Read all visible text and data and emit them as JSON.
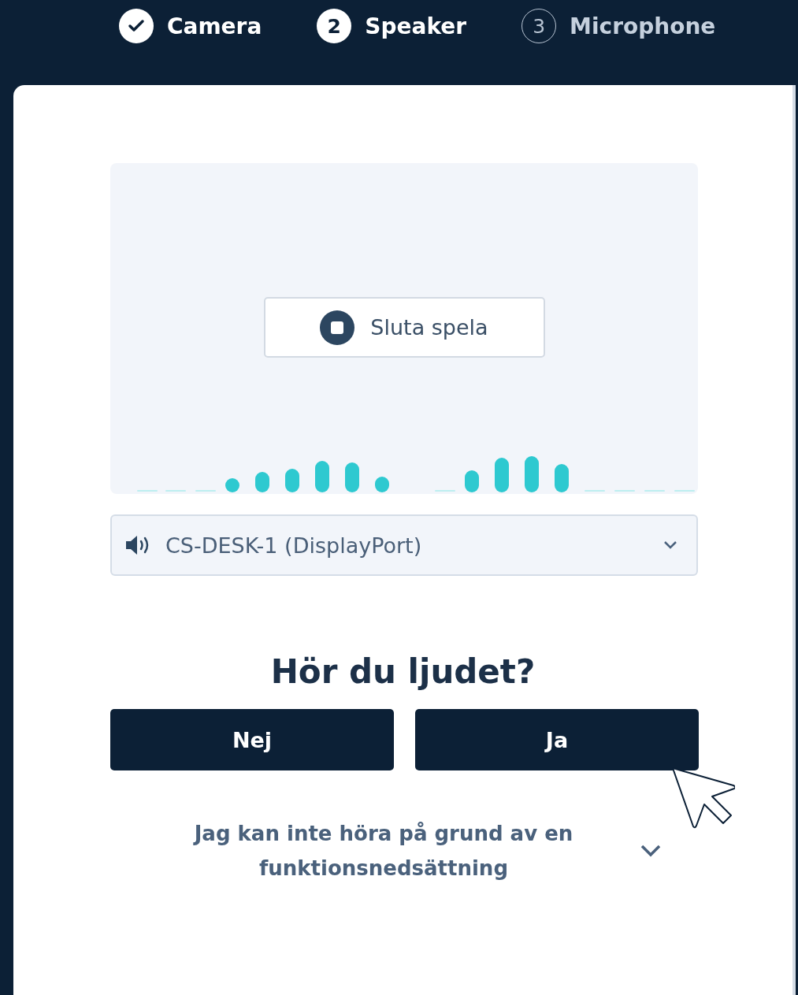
{
  "steps": [
    {
      "label": "Camera",
      "done": true,
      "selected": false
    },
    {
      "number": "2",
      "label": "Speaker",
      "done": false,
      "selected": true
    },
    {
      "number": "3",
      "label": "Microphone",
      "done": false,
      "selected": false
    }
  ],
  "preview": {
    "stop_button": {
      "label": "Sluta spela"
    }
  },
  "output_select": {
    "value": "CS-DESK-1 (DisplayPort)"
  },
  "question": "Hör du ljudet?",
  "answers": [
    {
      "label": "Nej"
    },
    {
      "label": "Ja"
    }
  ],
  "disclosure": {
    "text": "Jag kan inte höra på grund av en funktionsnedsättning",
    "expanded": false
  }
}
